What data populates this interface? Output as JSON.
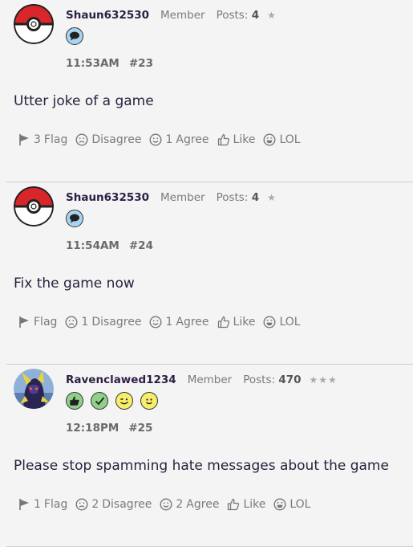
{
  "posts": [
    {
      "username": "Shaun632530",
      "role": "Member",
      "posts_label": "Posts:",
      "posts_count": "4",
      "stars": "★",
      "badges": [
        "chat-bubble-badge"
      ],
      "time": "11:53AM",
      "number": "#23",
      "message": "Utter joke of a game",
      "flag_count": "3",
      "disagree_count": "",
      "agree_count": "1",
      "avatar": "pokeball"
    },
    {
      "username": "Shaun632530",
      "role": "Member",
      "posts_label": "Posts:",
      "posts_count": "4",
      "stars": "★",
      "badges": [
        "chat-bubble-badge"
      ],
      "time": "11:54AM",
      "number": "#24",
      "message": "Fix the game now",
      "flag_count": "",
      "disagree_count": "1",
      "agree_count": "1",
      "avatar": "pokeball"
    },
    {
      "username": "Ravenclawed1234",
      "role": "Member",
      "posts_label": "Posts:",
      "posts_count": "470",
      "stars": "★★★",
      "badges": [
        "thumbs-up-badge",
        "checkmark-badge",
        "wink-badge",
        "smile-badge"
      ],
      "time": "12:18PM",
      "number": "#25",
      "message": "Please stop spamming hate messages about the game",
      "flag_count": "1",
      "disagree_count": "2",
      "agree_count": "2",
      "avatar": "character"
    }
  ],
  "actions": {
    "flag": "Flag",
    "disagree": "Disagree",
    "agree": "Agree",
    "like": "Like",
    "lol": "LOL"
  },
  "colors": {
    "background": "#f4f4f4",
    "username": "#2c1f45",
    "muted": "#7a7a7a",
    "divider": "#cfcfcf",
    "badge_blue": "#a9d3f2",
    "badge_green": "#8fd18a",
    "badge_yellow": "#f6ee6a"
  }
}
